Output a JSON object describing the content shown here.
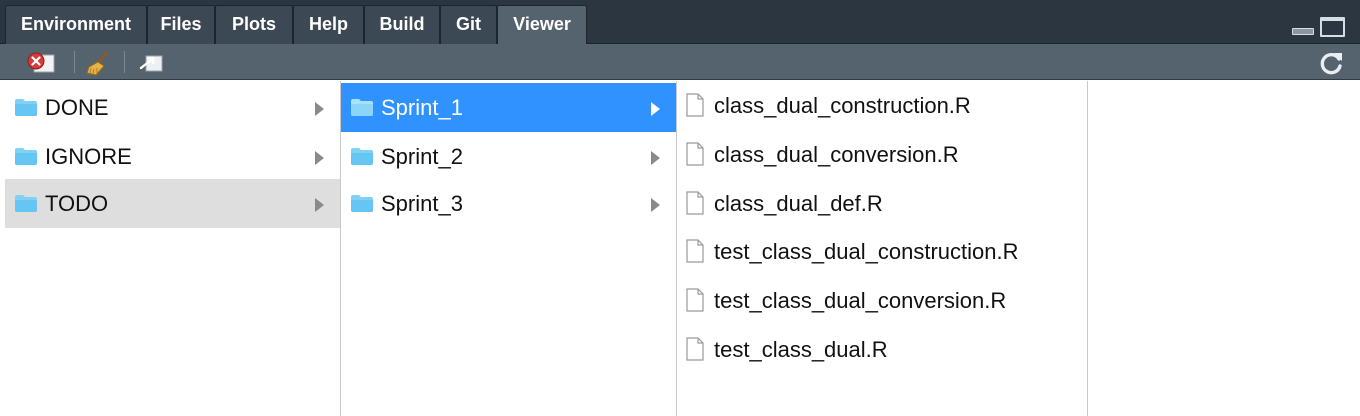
{
  "tabs": [
    {
      "label": "Environment"
    },
    {
      "label": "Files"
    },
    {
      "label": "Plots"
    },
    {
      "label": "Help"
    },
    {
      "label": "Build"
    },
    {
      "label": "Git"
    },
    {
      "label": "Viewer",
      "active": true
    }
  ],
  "toolbar": {
    "icons": [
      "remove-viewer-icon",
      "broom-clear-icon",
      "export-icon",
      "refresh-icon"
    ]
  },
  "columns": {
    "col1": {
      "items": [
        {
          "label": "DONE",
          "type": "folder"
        },
        {
          "label": "IGNORE",
          "type": "folder"
        },
        {
          "label": "TODO",
          "type": "folder",
          "selected": true
        }
      ]
    },
    "col2": {
      "items": [
        {
          "label": "Sprint_1",
          "type": "folder",
          "selected": true
        },
        {
          "label": "Sprint_2",
          "type": "folder"
        },
        {
          "label": "Sprint_3",
          "type": "folder"
        }
      ]
    },
    "col3": {
      "items": [
        {
          "label": "class_dual_construction.R",
          "type": "file"
        },
        {
          "label": "class_dual_conversion.R",
          "type": "file"
        },
        {
          "label": "class_dual_def.R",
          "type": "file"
        },
        {
          "label": "test_class_dual_construction.R",
          "type": "file"
        },
        {
          "label": "test_class_dual_conversion.R",
          "type": "file"
        },
        {
          "label": "test_class_dual.R",
          "type": "file"
        }
      ]
    }
  },
  "colors": {
    "tabbar_bg": "#2b3640",
    "toolbar_bg": "#55636f",
    "selected_blue": "#2f92ff",
    "selected_gray": "#dedede",
    "folder": "#7fd1f5"
  }
}
